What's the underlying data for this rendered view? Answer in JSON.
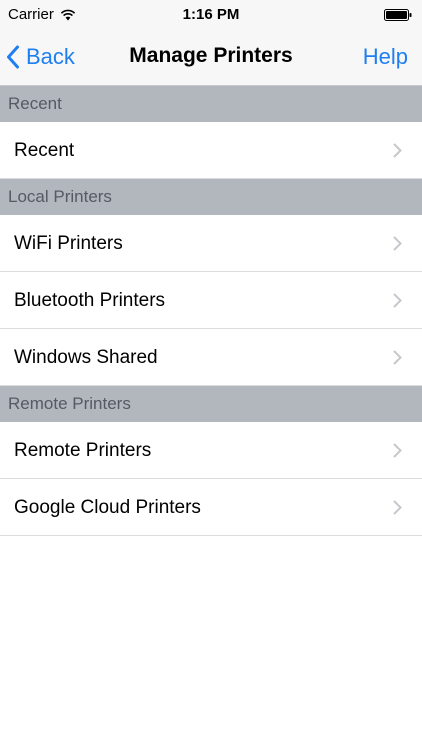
{
  "status_bar": {
    "carrier": "Carrier",
    "time": "1:16 PM"
  },
  "nav": {
    "back_label": "Back",
    "title": "Manage Printers",
    "help_label": "Help"
  },
  "sections": [
    {
      "header": "Recent",
      "items": [
        "Recent"
      ]
    },
    {
      "header": "Local Printers",
      "items": [
        "WiFi Printers",
        "Bluetooth Printers",
        "Windows Shared"
      ]
    },
    {
      "header": "Remote Printers",
      "items": [
        "Remote Printers",
        "Google Cloud Printers"
      ]
    }
  ],
  "colors": {
    "accent": "#1e7ff0",
    "section_header_bg": "#b2b6bd",
    "section_header_text": "#555a63",
    "chevron": "#c7c7cc"
  }
}
